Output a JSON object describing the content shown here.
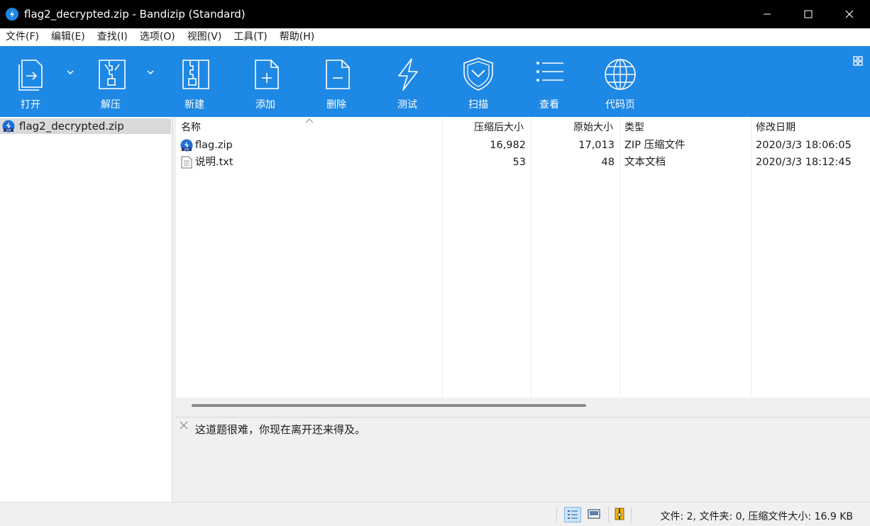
{
  "window": {
    "title": "flag2_decrypted.zip - Bandizip (Standard)"
  },
  "menu": [
    "文件(F)",
    "编辑(E)",
    "查找(I)",
    "选项(O)",
    "视图(V)",
    "工具(T)",
    "帮助(H)"
  ],
  "toolbar": {
    "open": "打开",
    "extract": "解压",
    "new": "新建",
    "add": "添加",
    "delete": "删除",
    "test": "测试",
    "scan": "扫描",
    "view": "查看",
    "codepage": "代码页"
  },
  "tree": {
    "root": "flag2_decrypted.zip"
  },
  "columns": {
    "name": "名称",
    "packed": "压缩后大小",
    "original": "原始大小",
    "type": "类型",
    "modified": "修改日期"
  },
  "files": [
    {
      "name": "flag.zip",
      "packed": "16,982",
      "original": "17,013",
      "type": "ZIP 压缩文件",
      "modified": "2020/3/3 18:06:05",
      "icon": "zip-file-icon"
    },
    {
      "name": "说明.txt",
      "packed": "53",
      "original": "48",
      "type": "文本文档",
      "modified": "2020/3/3 18:12:45",
      "icon": "text-file-icon"
    }
  ],
  "comment": "这道题很难，你现在离开还来得及。",
  "status": "文件: 2, 文件夹: 0, 压缩文件大小: 16.9 KB",
  "colors": {
    "toolbar": "#1e88e5",
    "titlebar": "#000000",
    "selection": "#d9d9d9"
  }
}
